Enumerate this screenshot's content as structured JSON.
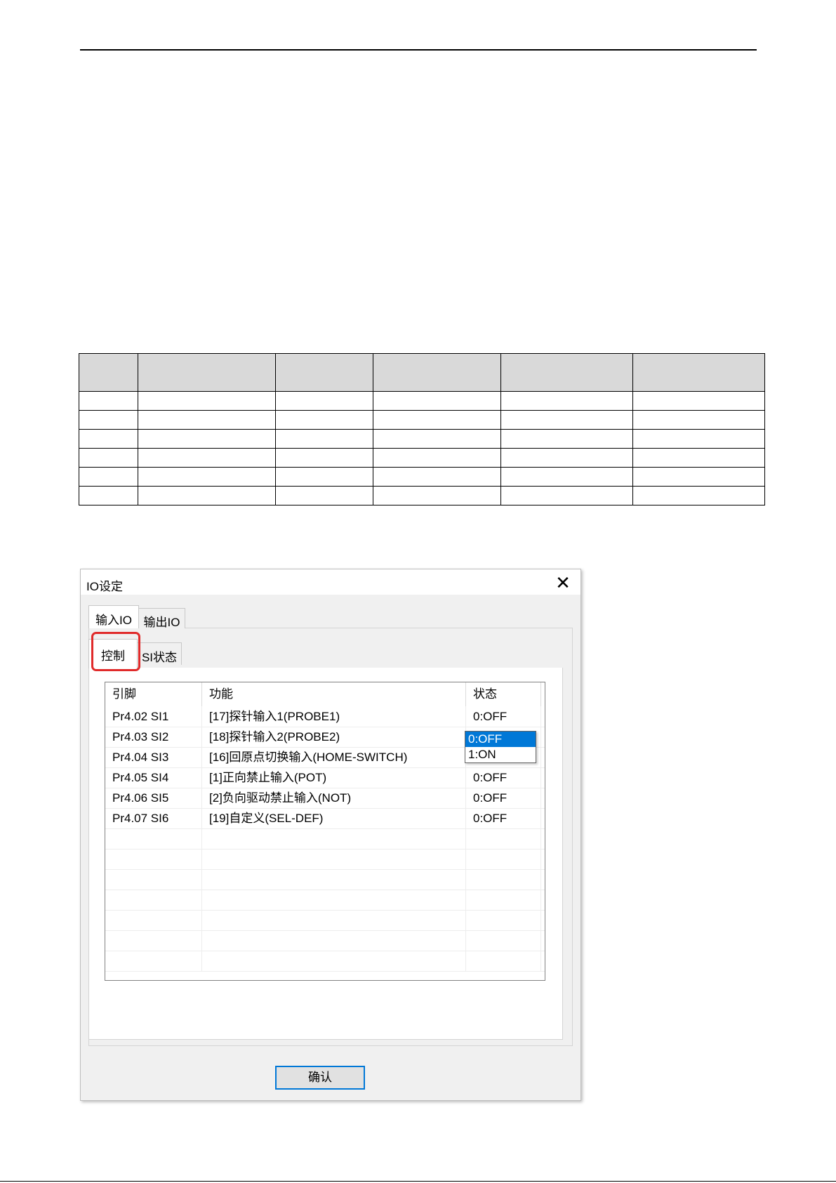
{
  "dialog": {
    "title": "IO设定",
    "close_glyph": "✕",
    "outer_tabs": [
      {
        "label": "输入IO"
      },
      {
        "label": "输出IO"
      }
    ],
    "inner_tabs": [
      {
        "label": "控制"
      },
      {
        "label": "SI状态"
      }
    ],
    "table": {
      "headers": [
        "引脚",
        "功能",
        "状态"
      ],
      "rows": [
        {
          "pin": "Pr4.02 SI1",
          "function": "[17]探针输入1(PROBE1)",
          "state": "0:OFF"
        },
        {
          "pin": "Pr4.03 SI2",
          "function": "[18]探针输入2(PROBE2)",
          "state": ""
        },
        {
          "pin": "Pr4.04 SI3",
          "function": "[16]回原点切换输入(HOME-SWITCH)",
          "state": ""
        },
        {
          "pin": "Pr4.05 SI4",
          "function": "[1]正向禁止输入(POT)",
          "state": "0:OFF"
        },
        {
          "pin": "Pr4.06 SI5",
          "function": "[2]负向驱动禁止输入(NOT)",
          "state": "0:OFF"
        },
        {
          "pin": "Pr4.07 SI6",
          "function": "[19]自定义(SEL-DEF)",
          "state": "0:OFF"
        }
      ]
    },
    "state_dropdown": {
      "options": [
        "0:OFF",
        "1:ON"
      ],
      "selected": "0:OFF"
    },
    "confirm_label": "确认"
  },
  "colors": {
    "highlight": "#e02a2a",
    "selection": "#0078d7"
  }
}
